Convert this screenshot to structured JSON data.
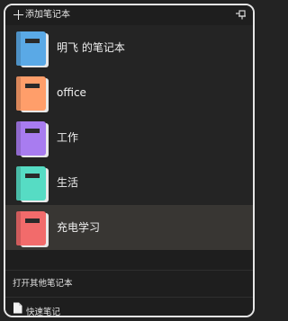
{
  "header": {
    "add_label": "添加笔记本"
  },
  "notebooks": [
    {
      "label": "明飞 的笔记本",
      "color": "#5aa9e6"
    },
    {
      "label": "office",
      "color": "#ff9e6a"
    },
    {
      "label": "工作",
      "color": "#a87cf0"
    },
    {
      "label": "生活",
      "color": "#56dcc4"
    },
    {
      "label": "充电学习",
      "color": "#f26b6b"
    }
  ],
  "footer": {
    "open_others_label": "打开其他笔记本",
    "quick_note_label": "快速笔记"
  },
  "icons": {
    "add": "plus-icon",
    "pin": "pin-icon",
    "notebook": "notebook-icon",
    "quick_note": "document-icon"
  }
}
